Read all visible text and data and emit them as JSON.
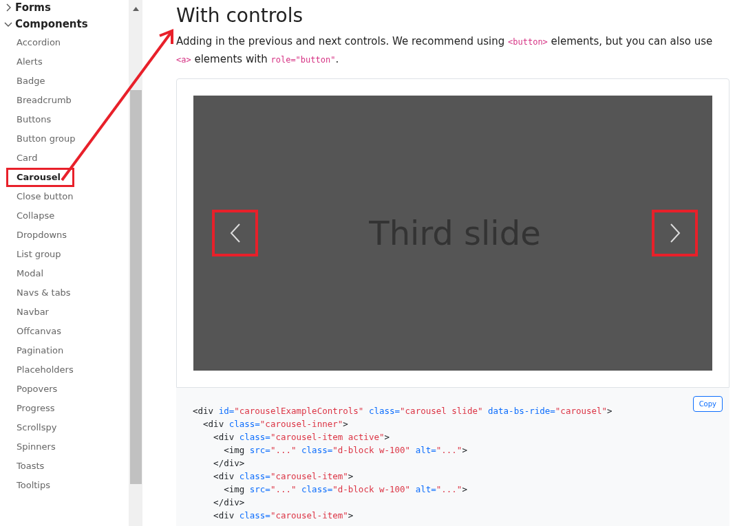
{
  "sidebar": {
    "collapsed_section": {
      "label": "Forms",
      "expanded": false
    },
    "section": {
      "label": "Components",
      "expanded": true
    },
    "items": [
      {
        "label": "Accordion",
        "highlighted": false
      },
      {
        "label": "Alerts",
        "highlighted": false
      },
      {
        "label": "Badge",
        "highlighted": false
      },
      {
        "label": "Breadcrumb",
        "highlighted": false
      },
      {
        "label": "Buttons",
        "highlighted": false
      },
      {
        "label": "Button group",
        "highlighted": false
      },
      {
        "label": "Card",
        "highlighted": false
      },
      {
        "label": "Carousel",
        "highlighted": true
      },
      {
        "label": "Close button",
        "highlighted": false
      },
      {
        "label": "Collapse",
        "highlighted": false
      },
      {
        "label": "Dropdowns",
        "highlighted": false
      },
      {
        "label": "List group",
        "highlighted": false
      },
      {
        "label": "Modal",
        "highlighted": false
      },
      {
        "label": "Navs & tabs",
        "highlighted": false
      },
      {
        "label": "Navbar",
        "highlighted": false
      },
      {
        "label": "Offcanvas",
        "highlighted": false
      },
      {
        "label": "Pagination",
        "highlighted": false
      },
      {
        "label": "Placeholders",
        "highlighted": false
      },
      {
        "label": "Popovers",
        "highlighted": false
      },
      {
        "label": "Progress",
        "highlighted": false
      },
      {
        "label": "Scrollspy",
        "highlighted": false
      },
      {
        "label": "Spinners",
        "highlighted": false
      },
      {
        "label": "Toasts",
        "highlighted": false
      },
      {
        "label": "Tooltips",
        "highlighted": false
      }
    ]
  },
  "section": {
    "heading": "With controls",
    "description": [
      {
        "kind": "text",
        "text": "Adding in the previous and next controls. We recommend using "
      },
      {
        "kind": "code",
        "text": "<button>"
      },
      {
        "kind": "text",
        "text": " elements, but you can also use "
      },
      {
        "kind": "code",
        "text": "<a>"
      },
      {
        "kind": "text",
        "text": " elements with "
      },
      {
        "kind": "code",
        "text": "role=\"button\""
      },
      {
        "kind": "text",
        "text": "."
      }
    ],
    "carousel": {
      "slide_label": "Third slide",
      "prev_highlighted": true,
      "next_highlighted": true
    },
    "code": {
      "copy_button": "Copy",
      "lines": [
        [
          {
            "kind": "plain",
            "text": "<div "
          },
          {
            "kind": "attr",
            "text": "id="
          },
          {
            "kind": "string",
            "text": "\"carouselExampleControls\""
          },
          {
            "kind": "attr",
            "text": " class="
          },
          {
            "kind": "string",
            "text": "\"carousel slide\""
          },
          {
            "kind": "attr",
            "text": " data-bs-ride="
          },
          {
            "kind": "string",
            "text": "\"carousel\""
          },
          {
            "kind": "plain",
            "text": ">"
          }
        ],
        [
          {
            "kind": "plain",
            "text": "  <div "
          },
          {
            "kind": "attr",
            "text": "class="
          },
          {
            "kind": "string",
            "text": "\"carousel-inner\""
          },
          {
            "kind": "plain",
            "text": ">"
          }
        ],
        [
          {
            "kind": "plain",
            "text": "    <div "
          },
          {
            "kind": "attr",
            "text": "class="
          },
          {
            "kind": "string",
            "text": "\"carousel-item active\""
          },
          {
            "kind": "plain",
            "text": ">"
          }
        ],
        [
          {
            "kind": "plain",
            "text": "      <img "
          },
          {
            "kind": "attr",
            "text": "src="
          },
          {
            "kind": "string",
            "text": "\"...\""
          },
          {
            "kind": "attr",
            "text": " class="
          },
          {
            "kind": "string",
            "text": "\"d-block w-100\""
          },
          {
            "kind": "attr",
            "text": " alt="
          },
          {
            "kind": "string",
            "text": "\"...\""
          },
          {
            "kind": "plain",
            "text": ">"
          }
        ],
        [
          {
            "kind": "plain",
            "text": "    </div>"
          }
        ],
        [
          {
            "kind": "plain",
            "text": "    <div "
          },
          {
            "kind": "attr",
            "text": "class="
          },
          {
            "kind": "string",
            "text": "\"carousel-item\""
          },
          {
            "kind": "plain",
            "text": ">"
          }
        ],
        [
          {
            "kind": "plain",
            "text": "      <img "
          },
          {
            "kind": "attr",
            "text": "src="
          },
          {
            "kind": "string",
            "text": "\"...\""
          },
          {
            "kind": "attr",
            "text": " class="
          },
          {
            "kind": "string",
            "text": "\"d-block w-100\""
          },
          {
            "kind": "attr",
            "text": " alt="
          },
          {
            "kind": "string",
            "text": "\"...\""
          },
          {
            "kind": "plain",
            "text": ">"
          }
        ],
        [
          {
            "kind": "plain",
            "text": "    </div>"
          }
        ],
        [
          {
            "kind": "plain",
            "text": "    <div "
          },
          {
            "kind": "attr",
            "text": "class="
          },
          {
            "kind": "string",
            "text": "\"carousel-item\""
          },
          {
            "kind": "plain",
            "text": ">"
          }
        ]
      ]
    }
  }
}
